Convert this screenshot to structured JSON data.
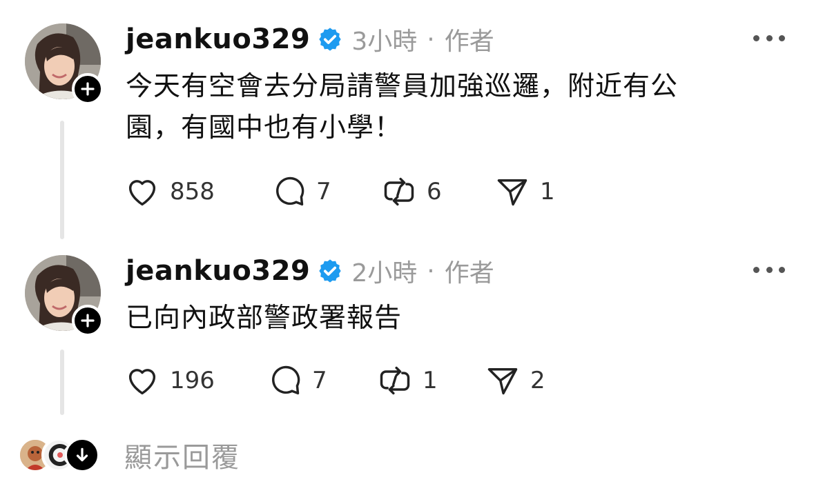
{
  "posts": [
    {
      "username": "jeankuo329",
      "time": "3小時",
      "separator": "·",
      "author_label": "作者",
      "text_lines": [
        "今天有空會去分局請警員加強巡邏，附近有公",
        "園，有國中也有小學！"
      ],
      "likes": "858",
      "comments": "7",
      "reposts": "6",
      "shares": "1"
    },
    {
      "username": "jeankuo329",
      "time": "2小時",
      "separator": "·",
      "author_label": "作者",
      "text_lines": [
        "已向內政部警政署報告"
      ],
      "likes": "196",
      "comments": "7",
      "reposts": "1",
      "shares": "2"
    }
  ],
  "show_replies_label": "顯示回覆",
  "icons": {
    "verified": "verified-badge-icon",
    "like": "heart-icon",
    "comment": "comment-bubble-icon",
    "repost": "repost-icon",
    "share": "paper-plane-icon",
    "more": "more-dots-icon",
    "follow": "plus-icon",
    "expand": "arrow-down-icon"
  },
  "colors": {
    "verified": "#1d9bf0",
    "meta_text": "#9a9a9a",
    "thread_line": "#e5e5e5"
  }
}
